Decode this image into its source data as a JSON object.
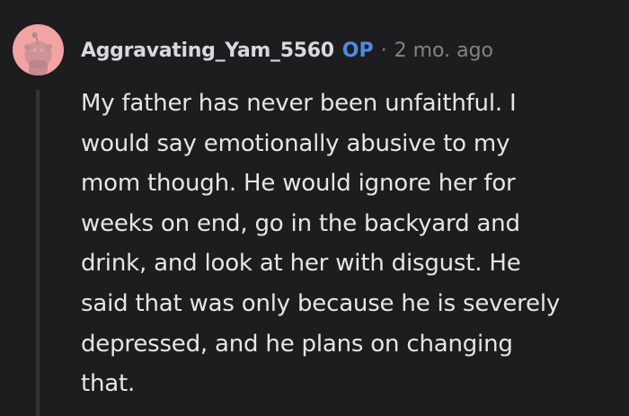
{
  "comment": {
    "username": "Aggravating_Yam_5560",
    "op_badge": "OP",
    "separator": "·",
    "timestamp": "2 mo. ago",
    "body_lines": [
      "My father has never been unfaithful. I",
      "would say emotionally abusive to my",
      "mom though. He would ignore her for",
      "weeks on end, go in the backyard and",
      "drink, and look at her with disgust. He",
      "said that was only because he is severely",
      "depressed, and he plans on changing",
      "that."
    ]
  },
  "colors": {
    "background": "#1d1d1f",
    "avatar_bg": "#f2a3a3",
    "op_accent": "#4f8be0",
    "muted": "#818384",
    "text": "#e4e6e8"
  },
  "icons": {
    "avatar": "snoo-avatar-icon"
  }
}
